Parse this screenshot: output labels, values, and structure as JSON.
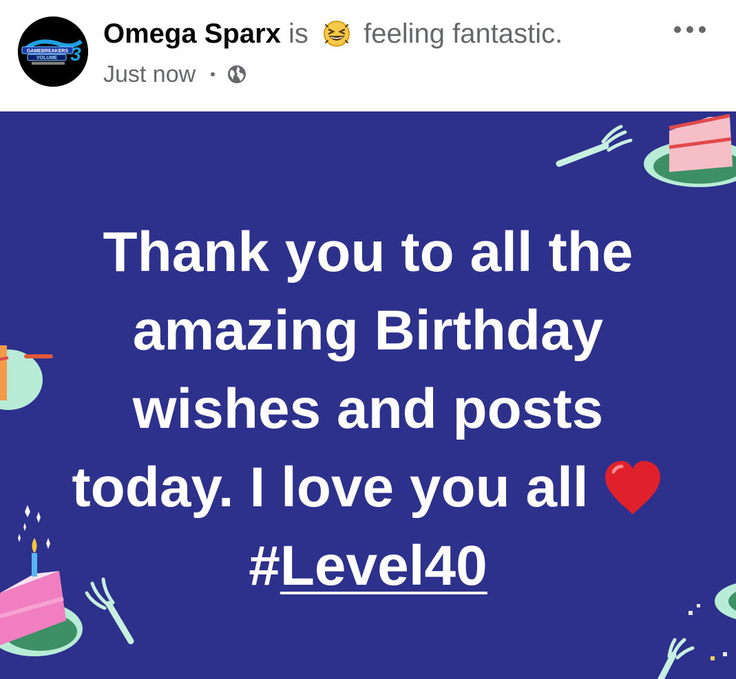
{
  "post": {
    "author": "Omega Sparx",
    "verb": "is",
    "feeling": "feeling fantastic.",
    "feeling_icon": "grinning-squinting-face-icon",
    "timestamp": "Just now",
    "audience_icon": "globe-icon",
    "more_icon": "more-options-icon"
  },
  "avatar": {
    "logo_text_1": "GAMEBREAKERS",
    "logo_text_2": "VOLUME",
    "logo_number": "3"
  },
  "background": {
    "color": "#2e318c",
    "theme": "birthday-cake"
  },
  "message": {
    "line1": "Thank you to all the",
    "line2": "amazing Birthday",
    "line3": "wishes and posts",
    "line4": "today. I love you all",
    "heart_icon": "red-heart-icon",
    "hashtag_prefix": "#",
    "hashtag_text": "Level40"
  }
}
